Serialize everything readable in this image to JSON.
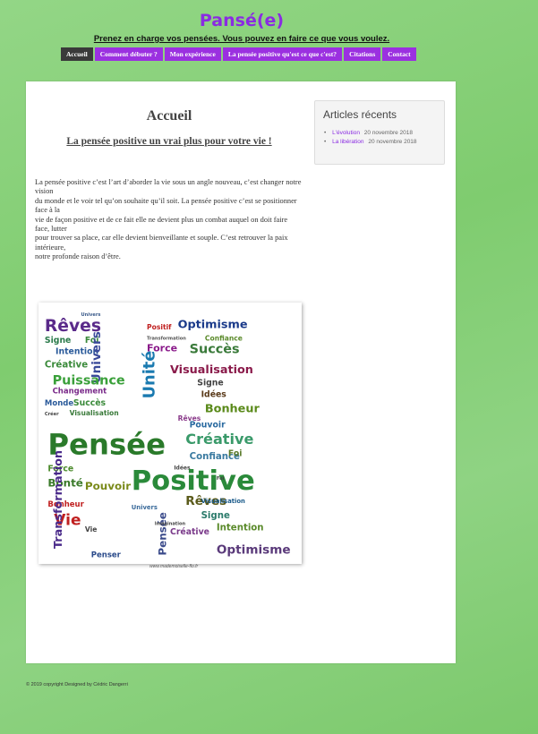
{
  "site": {
    "title": "Pansé(e)",
    "tagline": "Prenez en charge vos pensées. Vous pouvez en faire ce que vous voulez."
  },
  "nav": [
    {
      "label": "Accueil",
      "active": true
    },
    {
      "label": "Comment débuter ?",
      "active": false
    },
    {
      "label": "Mon expérience",
      "active": false
    },
    {
      "label": "La pensée positive qu'est ce que c'est?",
      "active": false
    },
    {
      "label": "Citations",
      "active": false
    },
    {
      "label": "Contact",
      "active": false
    }
  ],
  "main": {
    "title": "Accueil",
    "subtitle": "La pensée positive un vrai plus pour votre vie !",
    "paragraphs": [
      "La pensée positive c’est l’art d’aborder la vie sous un angle nouveau, c’est changer notre vision",
      "du monde et le voir tel qu’on souhaite qu’il soit. La pensée positive c’est se positionner face à la",
      "vie de façon positive et de ce fait elle ne devient plus un combat auquel on doit faire face, lutter",
      "pour trouver sa place, car elle devient bienveillante et souple. C’est retrouver la paix intérieure,",
      "notre profonde raison d’être."
    ],
    "image_credit": "www.mademoiselle-flo.fr"
  },
  "sidebar": {
    "title": "Articles récents",
    "items": [
      {
        "link": "L'évolution",
        "date": "20 novembre 2018"
      },
      {
        "link": "La libération",
        "date": "20 novembre 2018"
      }
    ]
  },
  "footer": "© 2019 copyright Designed by Cédric Dangerri",
  "colors": {
    "accent": "#9b30e0",
    "nav_active": "#3a3a3a",
    "background": "#86cf78"
  },
  "word_cloud": {
    "words": [
      "Rêves",
      "Univers",
      "Optimisme",
      "Signe",
      "Foi",
      "Positif",
      "Transformation",
      "Confiance",
      "Intention",
      "Force",
      "Succès",
      "Créative",
      "Univers",
      "Visualisation",
      "Puissance",
      "Changement",
      "Unité",
      "Signe",
      "Idées",
      "Monde",
      "Succès",
      "Bonheur",
      "Créer",
      "Visualisation",
      "Pouvoir",
      "Rêves",
      "Créative",
      "Pensée",
      "Confiance",
      "Idées",
      "Foi",
      "Positive",
      "Force",
      "Bonté",
      "Pouvoir",
      "Bonheur",
      "Vie",
      "Rêves",
      "Transformation",
      "Vie",
      "Penser",
      "Optimisme",
      "Intention",
      "Signe",
      "Univers",
      "Foi",
      "Créative",
      "Pensée",
      "Imagination",
      "Visualisation"
    ]
  }
}
